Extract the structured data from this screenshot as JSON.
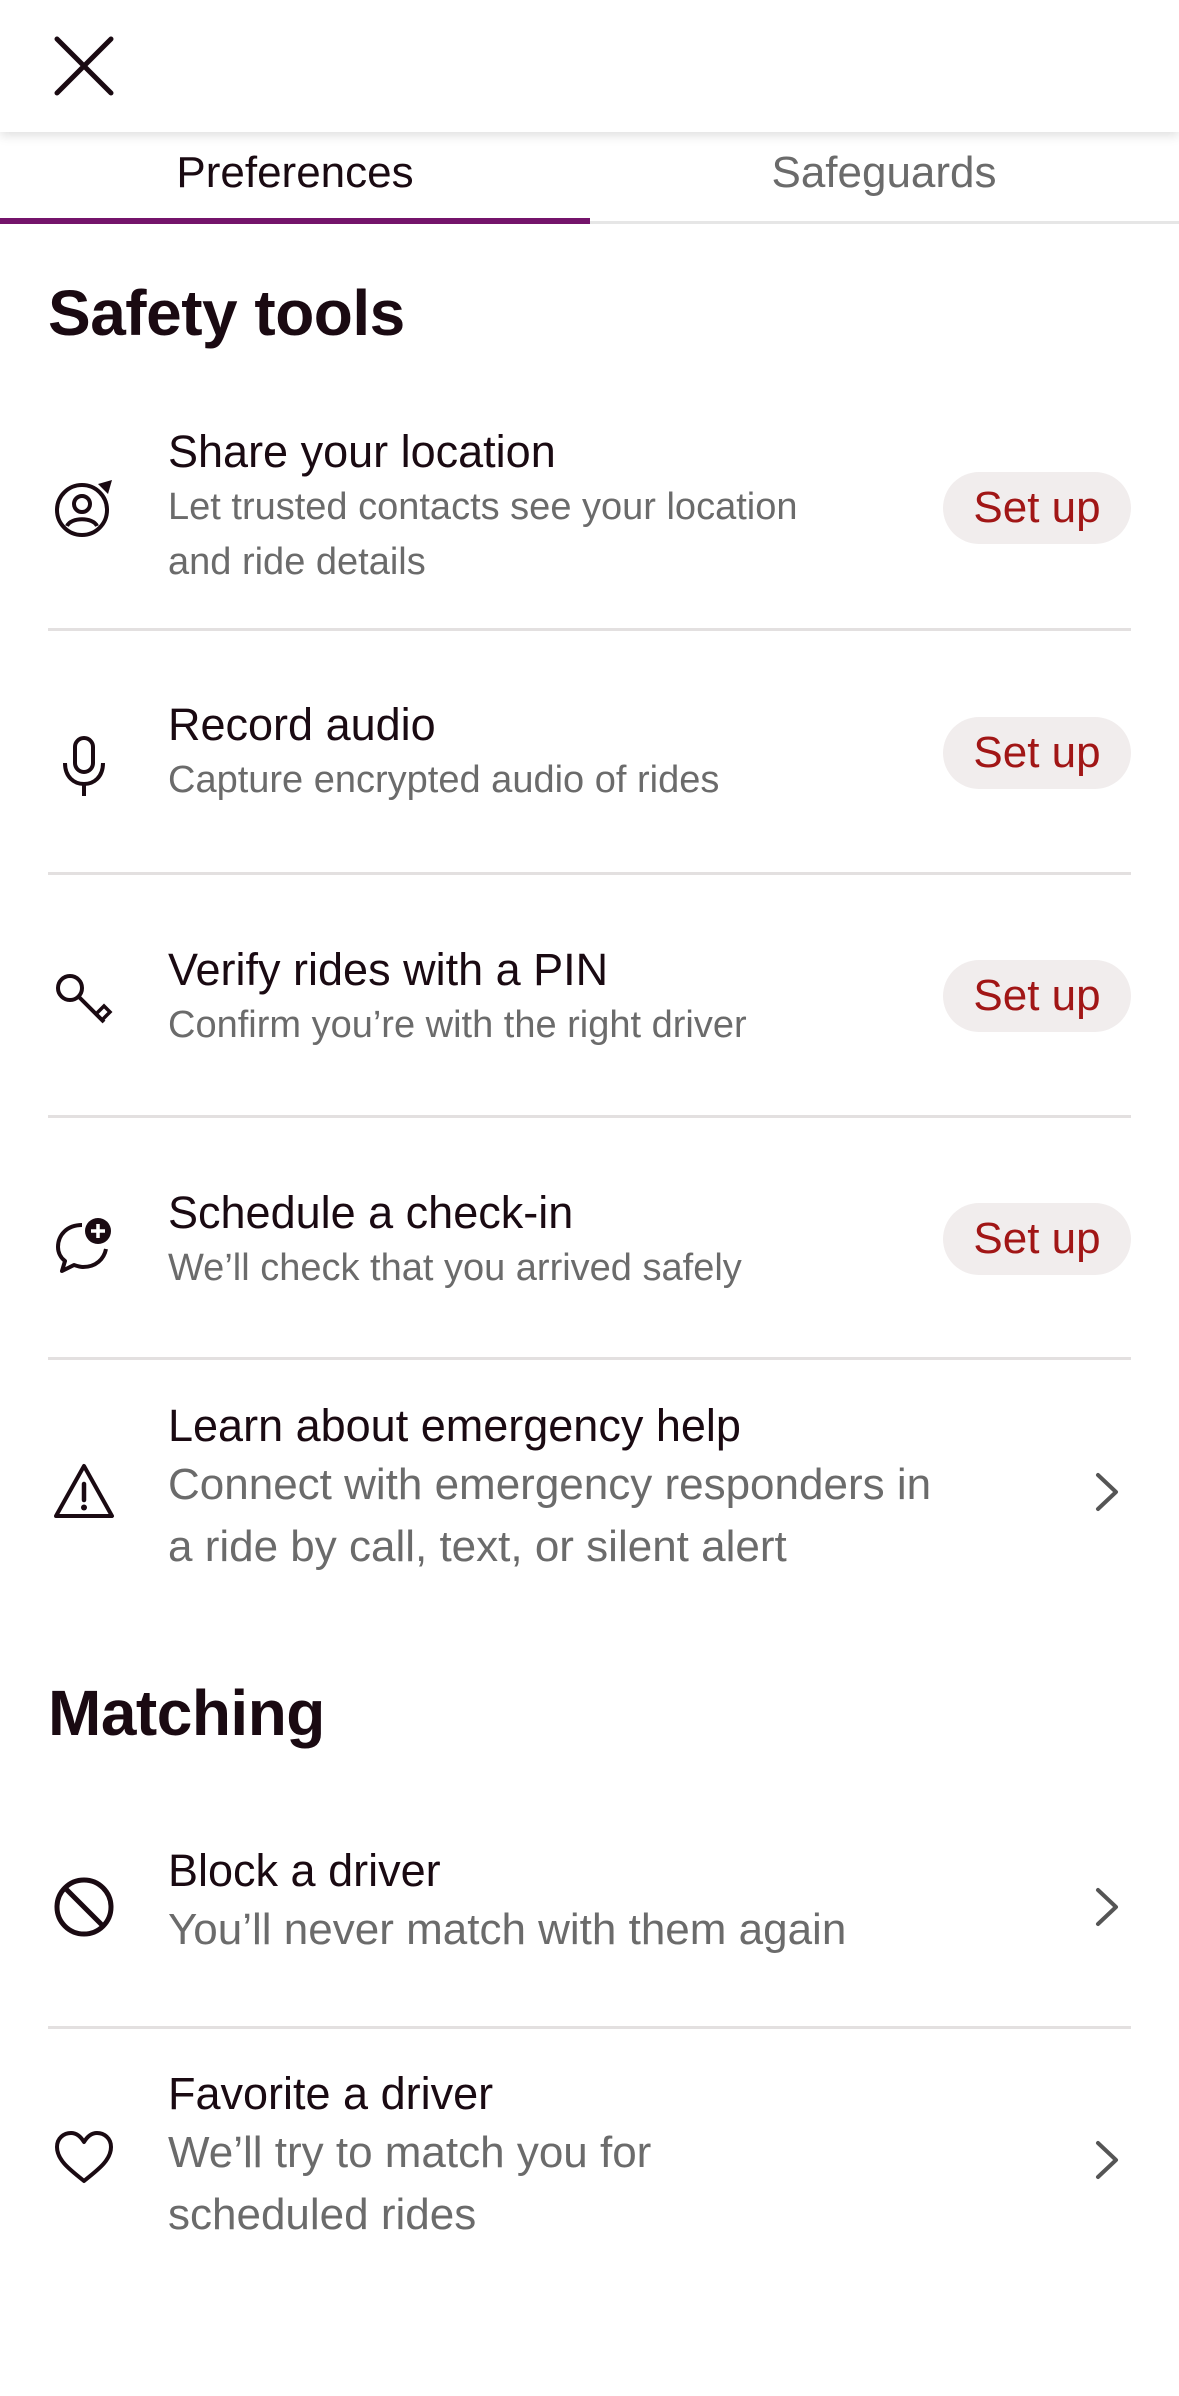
{
  "tabs": [
    {
      "label": "Preferences",
      "selected": true
    },
    {
      "label": "Safeguards",
      "selected": false
    }
  ],
  "safety_tools": {
    "title": "Safety tools",
    "items": [
      {
        "title": "Share your location",
        "desc_line1": "Let trusted contacts see your location",
        "desc_line2": "and ride details",
        "action": "Set up",
        "icon": "location-share-icon"
      },
      {
        "title": "Record audio",
        "desc_line1": "Capture encrypted audio of rides",
        "action": "Set up",
        "icon": "microphone-icon"
      },
      {
        "title": "Verify rides with a PIN",
        "desc_line1": "Confirm you’re with the right driver",
        "action": "Set up",
        "icon": "key-icon"
      },
      {
        "title": "Schedule a check-in",
        "desc_line1": "We’ll check that you arrived safely",
        "action": "Set up",
        "icon": "check-in-chat-icon"
      },
      {
        "title": "Learn about emergency help",
        "desc_line1": "Connect with emergency responders in",
        "desc_line2": "a ride by call, text, or silent alert",
        "icon": "warning-triangle-icon"
      }
    ]
  },
  "matching": {
    "title": "Matching",
    "items": [
      {
        "title": "Block a driver",
        "desc_line1": "You’ll never match with them again",
        "icon": "block-icon"
      },
      {
        "title": "Favorite a driver",
        "desc_line1": "We’ll try to match you for",
        "desc_line2": "scheduled rides",
        "icon": "heart-icon"
      }
    ]
  },
  "colors": {
    "accent": "#74146b",
    "action_text": "#a11616",
    "action_bg": "#f1eded"
  }
}
